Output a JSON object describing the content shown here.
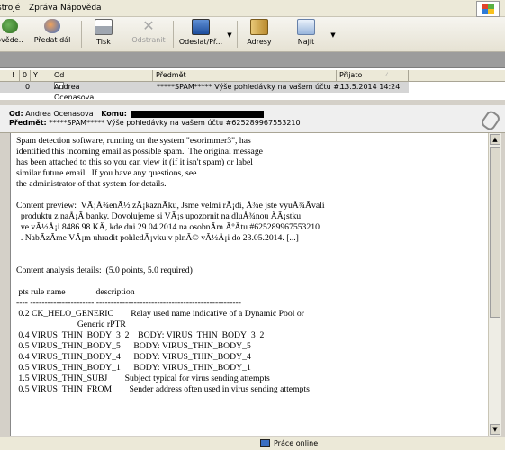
{
  "menu": {
    "items": [
      "strojé",
      "Zpráva",
      "Nápověda"
    ]
  },
  "toolbar": {
    "buttons": [
      {
        "label": "ověde..",
        "icon": "reply-icon",
        "disabled": false
      },
      {
        "label": "Předat dál",
        "icon": "forward-icon",
        "disabled": false
      },
      {
        "label": "Tisk",
        "icon": "print-icon",
        "disabled": false
      },
      {
        "label": "Odstranit",
        "icon": "delete-icon",
        "disabled": true
      },
      {
        "label": "Odeslat/Př...",
        "icon": "send-receive-icon",
        "disabled": false
      },
      {
        "label": "Adresy",
        "icon": "addresses-icon",
        "disabled": false
      },
      {
        "label": "Najít",
        "icon": "find-icon",
        "disabled": false
      }
    ]
  },
  "list": {
    "headers": {
      "flag1": "!",
      "flag2": "0",
      "flag3": "Υ",
      "from": "Od",
      "subject": "Předmět",
      "received": "Přijato"
    },
    "rows": [
      {
        "attach": "0",
        "from": "Andrea Ocenasova",
        "subject": "*****SPAM***** Výše pohledávky na vašem účtu #...",
        "received": "13.5.2014 14:24"
      }
    ]
  },
  "header": {
    "from_label": "Od:",
    "from": "Andrea Ocenasova",
    "to_label": "Komu:",
    "subject_label": "Předmět:",
    "subject": "*****SPAM***** Výše pohledávky na vašem účtu #625289967553210"
  },
  "body": {
    "text": "Spam detection software, running on the system \"esorimmer3\", has\nidentified this incoming email as possible spam.  The original message\nhas been attached to this so you can view it (if it isn't spam) or label\nsimilar future email.  If you have any questions, see\nthe administrator of that system for details.\n\nContent preview:  VÃ¡Å¾enÃ½ zÃ¡kaznÃ­ku, Jsme velmi rÃ¡di, Å¾e jste vyuÅ¾Ã­vali\n  produktu z naÅ¡Ã­ banky. Dovolujeme si VÃ¡s upozornit na dluÅ¾nou ÄÃ¡stku\n  ve vÃ½Å¡i 8486.98 KÄ, kde dni 29.04.2014 na osobnÃ­m ÃºÄtu #625289967553210\n  . NabÃ­zÃ­me VÃ¡m uhradit pohledÃ¡vku v plnÃ© vÃ½Å¡i do 23.05.2014. [...]\n\n\nContent analysis details:  (5.0 points, 5.0 required)\n\n pts rule name              description\n---- ---------------------- --------------------------------------------------\n 0.2 CK_HELO_GENERIC        Relay used name indicative of a Dynamic Pool or\n                            Generic rPTR\n 0.4 VIRUS_THIN_BODY_3_2    BODY: VIRUS_THIN_BODY_3_2\n 0.5 VIRUS_THIN_BODY_5      BODY: VIRUS_THIN_BODY_5\n 0.4 VIRUS_THIN_BODY_4      BODY: VIRUS_THIN_BODY_4\n 0.5 VIRUS_THIN_BODY_1      BODY: VIRUS_THIN_BODY_1\n 1.5 VIRUS_THIN_SUBJ        Subject typical for virus sending attempts\n 0.5 VIRUS_THIN_FROM        Sender address often used in virus sending attempts"
  },
  "status": {
    "online": "Práce online"
  }
}
